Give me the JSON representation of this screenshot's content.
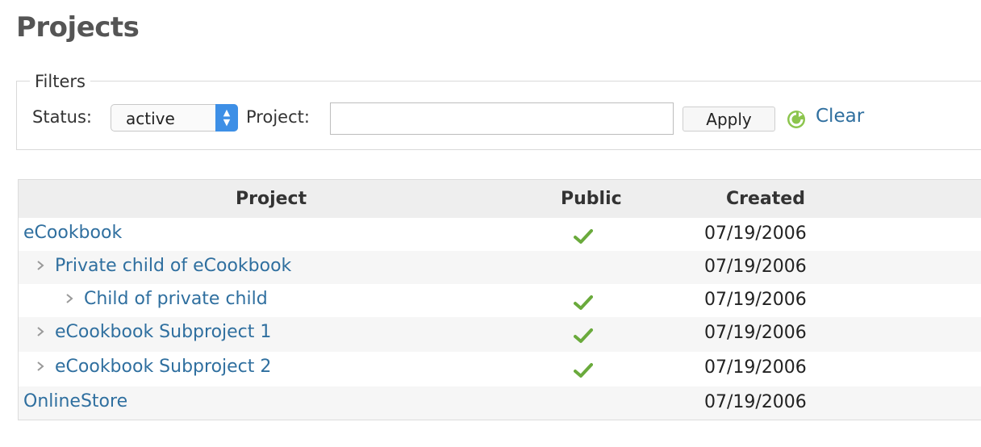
{
  "page": {
    "title": "Projects"
  },
  "filters": {
    "legend": "Filters",
    "status_label": "Status:",
    "status_value": "active",
    "project_label": "Project:",
    "project_value": "",
    "apply_label": "Apply",
    "clear_label": "Clear"
  },
  "table": {
    "headers": {
      "project": "Project",
      "public": "Public",
      "created": "Created"
    },
    "rows": [
      {
        "name": "eCookbook",
        "level": 0,
        "public": true,
        "created": "07/19/2006"
      },
      {
        "name": "Private child of eCookbook",
        "level": 1,
        "public": false,
        "created": "07/19/2006"
      },
      {
        "name": "Child of private child",
        "level": 2,
        "public": true,
        "created": "07/19/2006"
      },
      {
        "name": "eCookbook Subproject 1",
        "level": 1,
        "public": true,
        "created": "07/19/2006"
      },
      {
        "name": "eCookbook Subproject 2",
        "level": 1,
        "public": true,
        "created": "07/19/2006"
      },
      {
        "name": "OnlineStore",
        "level": 0,
        "public": false,
        "created": "07/19/2006"
      }
    ]
  },
  "colors": {
    "link": "#2f6f9f",
    "check": "#6aaa3c",
    "select_accent": "#3d8fe6",
    "header_bg": "#eeeeee"
  },
  "icons": {
    "public_flag": "checkmark-icon",
    "expander": "chevron-right-icon",
    "clear": "reload-icon"
  }
}
